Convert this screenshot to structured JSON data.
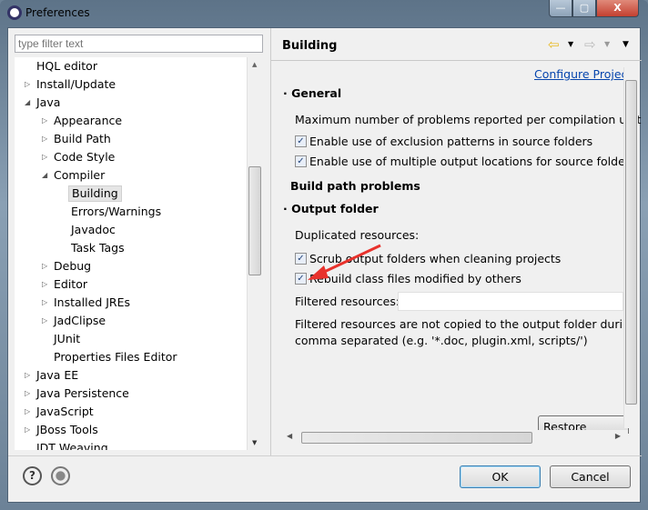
{
  "window": {
    "title": "Preferences",
    "minimize": "—",
    "maximize": "▢",
    "close": "X"
  },
  "filter": {
    "placeholder": "type filter text"
  },
  "tree": [
    {
      "label": "HQL editor",
      "level": 0,
      "arrow": ""
    },
    {
      "label": "Install/Update",
      "level": 0,
      "arrow": "collapsed"
    },
    {
      "label": "Java",
      "level": 0,
      "arrow": "expanded"
    },
    {
      "label": "Appearance",
      "level": 1,
      "arrow": "collapsed"
    },
    {
      "label": "Build Path",
      "level": 1,
      "arrow": "collapsed"
    },
    {
      "label": "Code Style",
      "level": 1,
      "arrow": "collapsed"
    },
    {
      "label": "Compiler",
      "level": 1,
      "arrow": "expanded"
    },
    {
      "label": "Building",
      "level": 2,
      "arrow": "",
      "selected": true
    },
    {
      "label": "Errors/Warnings",
      "level": 2,
      "arrow": ""
    },
    {
      "label": "Javadoc",
      "level": 2,
      "arrow": ""
    },
    {
      "label": "Task Tags",
      "level": 2,
      "arrow": ""
    },
    {
      "label": "Debug",
      "level": 1,
      "arrow": "collapsed"
    },
    {
      "label": "Editor",
      "level": 1,
      "arrow": "collapsed"
    },
    {
      "label": "Installed JREs",
      "level": 1,
      "arrow": "collapsed"
    },
    {
      "label": "JadClipse",
      "level": 1,
      "arrow": "collapsed"
    },
    {
      "label": "JUnit",
      "level": 1,
      "arrow": ""
    },
    {
      "label": "Properties Files Editor",
      "level": 1,
      "arrow": ""
    },
    {
      "label": "Java EE",
      "level": 0,
      "arrow": "collapsed"
    },
    {
      "label": "Java Persistence",
      "level": 0,
      "arrow": "collapsed"
    },
    {
      "label": "JavaScript",
      "level": 0,
      "arrow": "collapsed"
    },
    {
      "label": "JBoss Tools",
      "level": 0,
      "arrow": "collapsed"
    },
    {
      "label": "JDT Weaving",
      "level": 0,
      "arrow": ""
    }
  ],
  "page": {
    "title": "Building",
    "configure_link": "Configure Projec",
    "general": "General",
    "max_problems": "Maximum number of problems reported per compilation unit",
    "exclusion": {
      "label": "Enable use of exclusion patterns in source folders",
      "checked": true
    },
    "multiple_output": {
      "label": "Enable use of multiple output locations for source folders",
      "checked": true
    },
    "build_path_problems": "Build path problems",
    "output_folder": "Output folder",
    "duplicated": "Duplicated resources:",
    "scrub": {
      "label": "Scrub output folders when cleaning projects",
      "checked": true
    },
    "rebuild": {
      "label": "Rebuild class files modified by others",
      "checked": true
    },
    "filtered_label": "Filtered resources:",
    "filtered_value": "",
    "filtered_desc1": "Filtered resources are not copied to the output folder during",
    "filtered_desc2": "comma separated (e.g. '*.doc, plugin.xml, scripts/')",
    "restore": "Restore Defaults"
  },
  "footer": {
    "ok": "OK",
    "cancel": "Cancel",
    "help": "?"
  },
  "colors": {
    "annotation_arrow": "#e8322c",
    "link": "#0645ad",
    "selection": "#e5e5e5"
  }
}
